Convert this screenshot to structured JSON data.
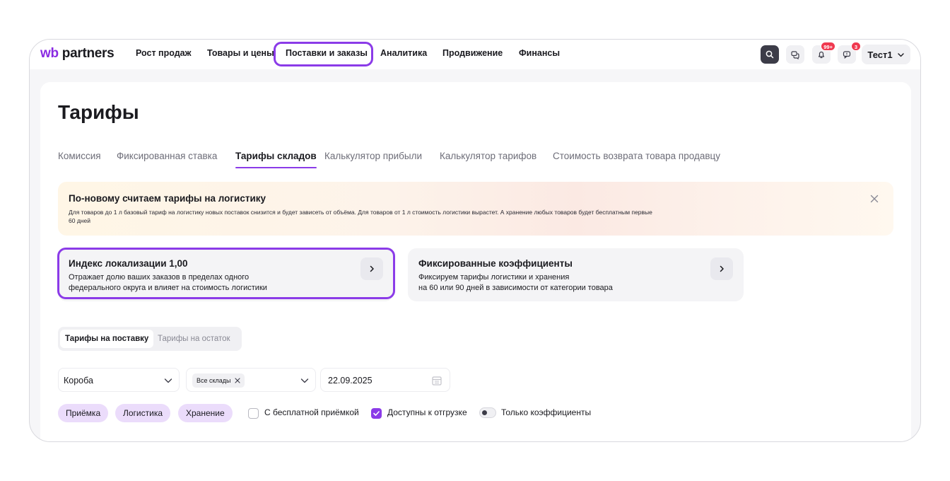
{
  "nav": {
    "logo_wb": "wb",
    "logo_partners": "partners",
    "items": [
      {
        "label": "Рост продаж"
      },
      {
        "label": "Товары и цены"
      },
      {
        "label": "Поставки и заказы"
      },
      {
        "label": "Аналитика"
      },
      {
        "label": "Продвижение"
      },
      {
        "label": "Финансы"
      }
    ],
    "highlighted_item": "Поставки и заказы",
    "icons": [
      "search-icon",
      "chat-icon",
      "bell-icon",
      "message-icon"
    ],
    "notifications_badge": "99+",
    "messages_badge": "3",
    "user_name": "Тест1"
  },
  "page": {
    "title": "Тарифы",
    "tabs": [
      {
        "label": "Комиссия"
      },
      {
        "label": "Фиксированная ставка"
      },
      {
        "label": "Тарифы складов"
      },
      {
        "label": "Калькулятор прибыли"
      },
      {
        "label": "Калькулятор тарифов"
      },
      {
        "label": "Стоимость возврата товара продавцу"
      }
    ],
    "active_tab": "Тарифы складов"
  },
  "banner": {
    "title": "По-новому считаем тарифы на логистику",
    "text": "Для товаров до 1 л базовый тариф на логистику новых поставок снизится и будет зависеть от объёма. Для товаров от 1 л стоимость логистики вырастет. А хранение любых товаров будет бесплатным первые 60 дней"
  },
  "cards": [
    {
      "title": "Индекс локализации 1,00",
      "line1": "Отражает долю ваших заказов в пределах одного",
      "line2": "федерального округа и влияет на стоимость логистики"
    },
    {
      "title": "Фиксированные коэффициенты",
      "line1": "Фиксируем тарифы логистики и хранения",
      "line2": "на 60 или 90 дней в зависимости от категории товара"
    }
  ],
  "segmented": {
    "options": [
      {
        "label": "Тарифы на поставку"
      },
      {
        "label": "Тарифы на остаток"
      }
    ],
    "selected": "Тарифы на поставку"
  },
  "filters": {
    "box_type": "Короба",
    "warehouses_chip": "Все склады",
    "date": "22.09.2025"
  },
  "pills": [
    {
      "label": "Приёмка"
    },
    {
      "label": "Логистика"
    },
    {
      "label": "Хранение"
    }
  ],
  "options": {
    "free_acceptance": {
      "label": "С бесплатной приёмкой",
      "checked": false
    },
    "available_shipping": {
      "label": "Доступны к отгрузке",
      "checked": true
    },
    "only_coefficients": {
      "label": "Только коэффициенты",
      "on": false
    }
  },
  "colors": {
    "accent": "#8b3be8",
    "pill_bg": "#ebdcfb",
    "badge": "#f0394f"
  }
}
